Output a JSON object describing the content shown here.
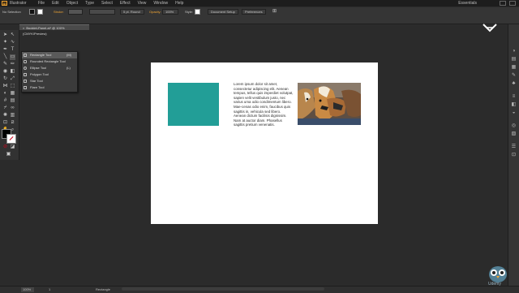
{
  "menubar": {
    "app_name": "Illustrator",
    "app_logo": "Ai",
    "menus": [
      "File",
      "Edit",
      "Object",
      "Type",
      "Select",
      "Effect",
      "View",
      "Window",
      "Help"
    ],
    "workspace": "Essentials"
  },
  "controlbar": {
    "selection": "No Selection",
    "stroke_label": "Stroke:",
    "brush_value": "5 pt. Round",
    "opacity_label": "Opacity:",
    "opacity_value": "100%",
    "style_label": "Style:",
    "document_setup": "Document Setup",
    "preferences": "Preferences"
  },
  "document_tab": {
    "title": "Booklet-Panel.ai* @ 100% (CMYK/Preview)"
  },
  "flyout": {
    "items": [
      {
        "label": "Rectangle Tool",
        "shortcut": "(M)",
        "icon": "rectangle-icon"
      },
      {
        "label": "Rounded Rectangle Tool",
        "shortcut": "",
        "icon": "rounded-rectangle-icon"
      },
      {
        "label": "Ellipse Tool",
        "shortcut": "(L)",
        "icon": "ellipse-icon"
      },
      {
        "label": "Polygon Tool",
        "shortcut": "",
        "icon": "polygon-icon"
      },
      {
        "label": "Star Tool",
        "shortcut": "",
        "icon": "star-icon"
      },
      {
        "label": "Flare Tool",
        "shortcut": "",
        "icon": "flare-icon"
      }
    ]
  },
  "artboard": {
    "text": "Lorem ipsum dolor sit amet, consectetur adipiscing elit. Aenean tempus, tellus quis imperdiet volutpat, sapien velit vestibulum justo, nec varius uma odio condimentum libero. Mae-cenas odio enim, faucibus quis sagittis in, vehicula sed libero. Aenean dictum facilisis dignissim. Nam at auctor diam. Phasellus sagittis pretium venenatis.",
    "teal_color": "#229e97"
  },
  "statusbar": {
    "zoom": "100%",
    "page": "1",
    "tool": "Rectangle"
  },
  "watermark": {
    "text": "Udemy"
  }
}
